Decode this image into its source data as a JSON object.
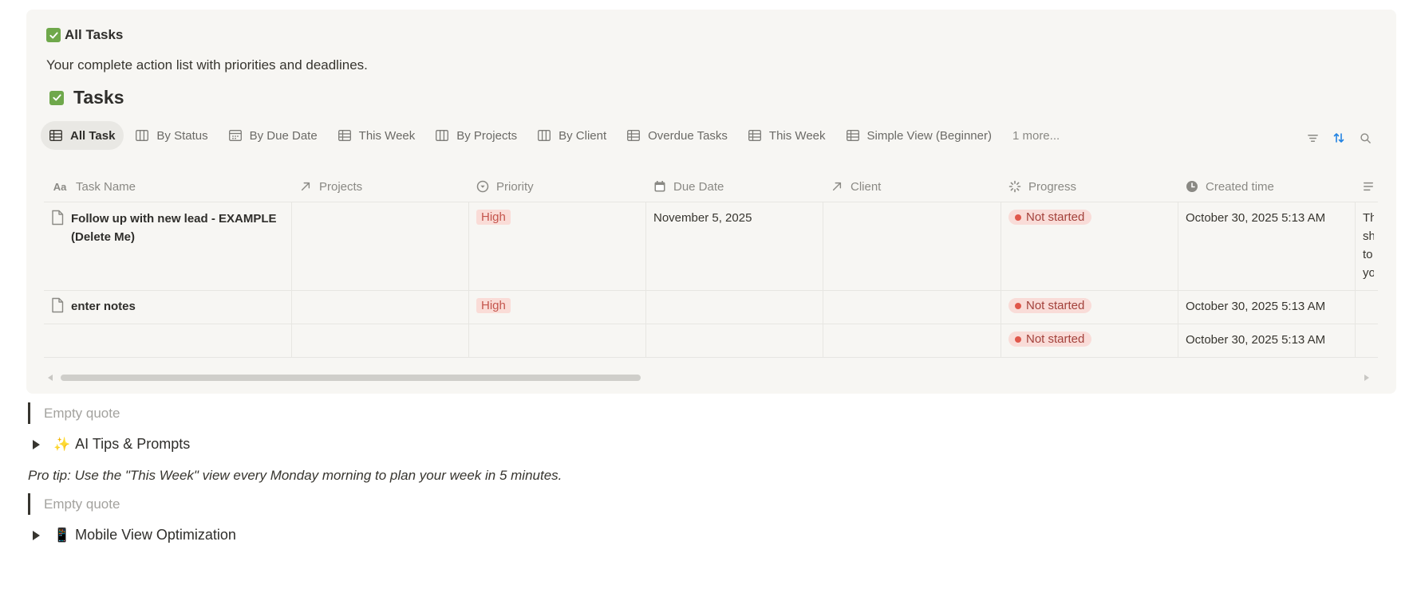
{
  "callout": {
    "title": "All Tasks",
    "description": "Your complete action list with priorities and deadlines."
  },
  "database": {
    "title": "Tasks",
    "tabs": [
      {
        "label": "All Task",
        "icon": "table-icon",
        "active": true
      },
      {
        "label": "By Status",
        "icon": "board-icon"
      },
      {
        "label": "By Due Date",
        "icon": "calendar-icon"
      },
      {
        "label": "This Week",
        "icon": "table-icon"
      },
      {
        "label": "By Projects",
        "icon": "board-icon"
      },
      {
        "label": "By Client",
        "icon": "board-icon"
      },
      {
        "label": "Overdue Tasks",
        "icon": "table-icon"
      },
      {
        "label": "This Week",
        "icon": "table-icon"
      },
      {
        "label": "Simple View (Beginner)",
        "icon": "table-icon"
      }
    ],
    "more_label": "1 more...",
    "columns": [
      "Task Name",
      "Projects",
      "Priority",
      "Due Date",
      "Client",
      "Progress",
      "Created time"
    ],
    "rows": [
      {
        "task": "Follow up with new lead - EXAMPLE (Delete Me)",
        "priority": "High",
        "due": "November 5, 2025",
        "progress": "Not started",
        "created": "October 30, 2025 5:13 AM",
        "clipped": "Th\nsh\nto\nyo"
      },
      {
        "task": "enter notes",
        "priority": "High",
        "due": "",
        "progress": "Not started",
        "created": "October 30, 2025 5:13 AM",
        "clipped": ""
      },
      {
        "task": "",
        "priority": "",
        "due": "",
        "progress": "Not started",
        "created": "October 30, 2025 5:13 AM",
        "clipped": ""
      }
    ],
    "colors": {
      "priority_bg": "#fadcd7",
      "status_dot": "#e0574b",
      "check": "#6fa84b",
      "sort_active": "#2383e2"
    }
  },
  "blocks": {
    "quote1": "Empty quote",
    "toggle1": {
      "emoji": "✨",
      "label": "AI Tips & Prompts"
    },
    "tip": "Pro tip: Use the \"This Week\" view every Monday morning to plan your week in 5 minutes.",
    "quote2": "Empty quote",
    "toggle2": {
      "emoji": "📱",
      "label": "Mobile View Optimization"
    }
  }
}
